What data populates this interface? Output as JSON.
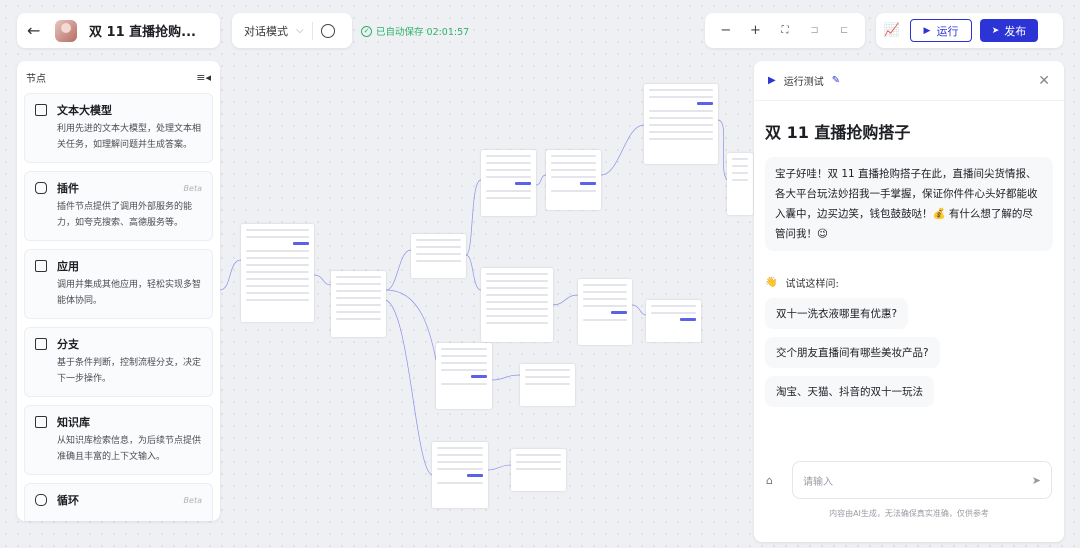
{
  "header": {
    "back_icon": "arrow-left-icon",
    "title": "双 11 直播抢购...",
    "mode_label": "对话模式",
    "autosave_text": "已自动保存 02:01:57"
  },
  "toolbar": {
    "zoom_out": "−",
    "zoom_in": "+",
    "fit": "⛶",
    "run_label": "运行",
    "publish_label": "发布"
  },
  "sidebar": {
    "title": "节点",
    "items": [
      {
        "label": "文本大模型",
        "desc": "利用先进的文本大模型，处理文本相关任务，如理解问题并生成答案。",
        "beta": "",
        "icon": "cube-icon"
      },
      {
        "label": "插件",
        "desc": "插件节点提供了调用外部服务的能力，如夸克搜索、高德服务等。",
        "beta": "Beta",
        "icon": "puzzle-icon"
      },
      {
        "label": "应用",
        "desc": "调用并集成其他应用，轻松实现多智能体协同。",
        "beta": "",
        "icon": "grid-icon"
      },
      {
        "label": "分支",
        "desc": "基于条件判断，控制流程分支，决定下一步操作。",
        "beta": "",
        "icon": "branch-icon"
      },
      {
        "label": "知识库",
        "desc": "从知识库检索信息，为后续节点提供准确且丰富的上下文输入。",
        "beta": "",
        "icon": "book-icon"
      },
      {
        "label": "循环",
        "desc": "",
        "beta": "Beta",
        "icon": "loop-icon"
      }
    ]
  },
  "test_panel": {
    "header_label": "运行测试",
    "bot_title": "双 11 直播抢购搭子",
    "welcome": "宝子好哇！双 11 直播抢购搭子在此，直播间尖货情报、各大平台玩法妙招我一手掌握，保证你件件心头好都能收入囊中，边买边笑，钱包鼓鼓哒！💰 有什么想了解的尽管问我！😉",
    "try_label": "试试这样问:",
    "suggestions": [
      "双十一洗衣液哪里有优惠?",
      "交个朋友直播间有哪些美妆产品?",
      "淘宝、天猫、抖音的双十一玩法"
    ],
    "input_placeholder": "请输入",
    "disclaimer": "内容由AI生成，无法确保真实准确，仅供参考"
  },
  "colors": {
    "accent": "#2d34d6",
    "success": "#2fb36c"
  }
}
